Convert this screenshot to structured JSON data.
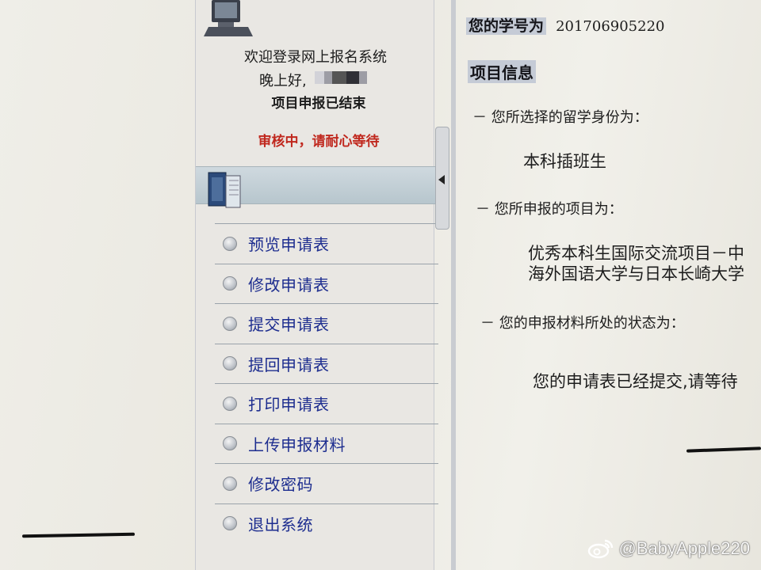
{
  "sidebar": {
    "welcome": "欢迎登录网上报名系统",
    "greeting": "晚上好,",
    "project_status": "项目申报已结束",
    "review_status": "审核中，请耐心等待",
    "review_color": "#c0281e",
    "menu": [
      {
        "label": "预览申请表",
        "icon": "radio-bullet-icon"
      },
      {
        "label": "修改申请表",
        "icon": "radio-bullet-icon"
      },
      {
        "label": "提交申请表",
        "icon": "radio-bullet-icon"
      },
      {
        "label": "提回申请表",
        "icon": "radio-bullet-icon"
      },
      {
        "label": "打印申请表",
        "icon": "radio-bullet-icon"
      },
      {
        "label": "上传申报材料",
        "icon": "radio-bullet-icon"
      },
      {
        "label": "修改密码",
        "icon": "radio-bullet-icon"
      },
      {
        "label": "退出系统",
        "icon": "radio-bullet-icon"
      }
    ],
    "menu_color": "#1d2d8f"
  },
  "main": {
    "student_id_label": "您的学号为",
    "student_id": "201706905220",
    "section_title": "项目信息",
    "identity_label": "－ 您所选择的留学身份为：",
    "identity_value": "本科插班生",
    "project_label": "－ 您所申报的项目为：",
    "project_value_line1": "优秀本科生国际交流项目－中",
    "project_value_line2": "海外国语大学与日本长崎大学",
    "status_label": "－ 您的申报材料所处的状态为：",
    "status_value": "您的申请表已经提交,请等待"
  },
  "watermark": {
    "text": "@BabyApple220",
    "icon": "weibo-logo-icon"
  }
}
